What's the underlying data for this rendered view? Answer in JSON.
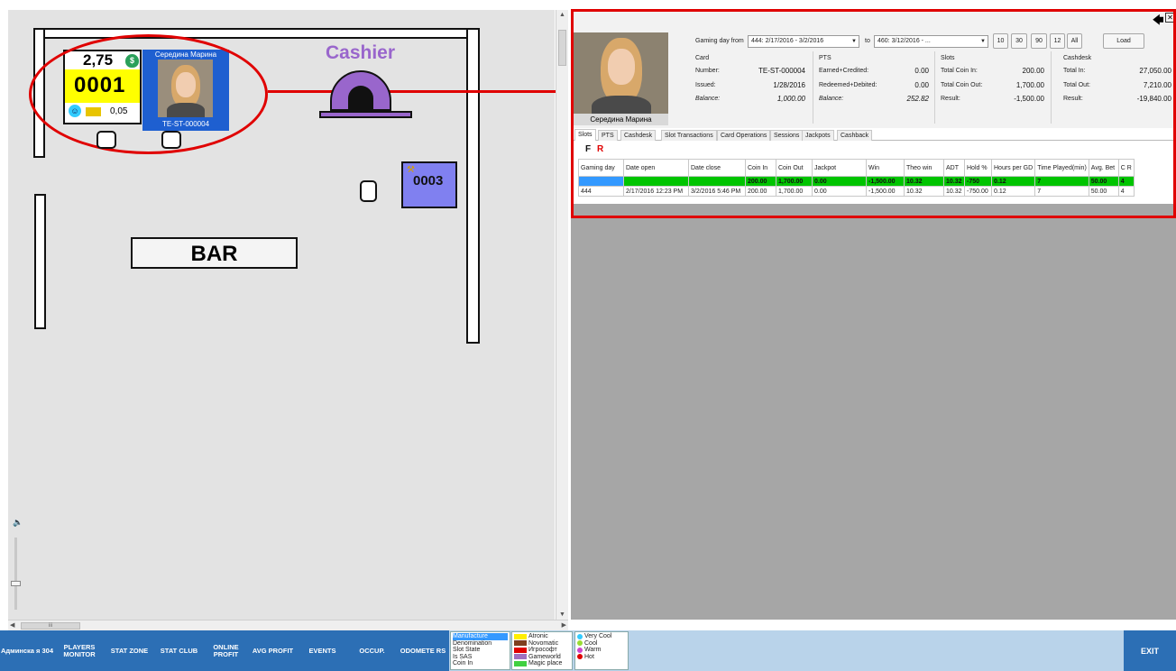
{
  "floor": {
    "cashier_label": "Cashier",
    "bar_label": "BAR",
    "machine_0001": {
      "credit": "2,75",
      "number": "0001",
      "denomination": "0,05",
      "player_name": "Середина Марина",
      "card_number": "TE-ST-000004"
    },
    "machine_0003": {
      "number": "0003"
    }
  },
  "panel": {
    "photo_caption": "Середина Марина",
    "gaming_day_from_label": "Gaming day from",
    "from_value": "444: 2/17/2016 - 3/2/2016",
    "to_label": "to",
    "to_value": "460: 3/12/2016 - ...",
    "range_buttons": [
      "10",
      "30",
      "90",
      "12",
      "All"
    ],
    "load_button": "Load",
    "card": {
      "title": "Card",
      "number_label": "Number:",
      "number_value": "TE-ST-000004",
      "issued_label": "Issued:",
      "issued_value": "1/28/2016",
      "balance_label": "Balance:",
      "balance_value": "1,000.00"
    },
    "pts": {
      "title": "PTS",
      "earned_label": "Earned+Credited:",
      "earned_value": "0.00",
      "redeemed_label": "Redeemed+Debited:",
      "redeemed_value": "0.00",
      "balance_label": "Balance:",
      "balance_value": "252.82"
    },
    "slots": {
      "title": "Slots",
      "coin_in_label": "Total Coin In:",
      "coin_in_value": "200.00",
      "coin_out_label": "Total Coin Out:",
      "coin_out_value": "1,700.00",
      "result_label": "Result:",
      "result_value": "-1,500.00"
    },
    "cashdesk": {
      "title": "Cashdesk",
      "in_label": "Total In:",
      "in_value": "27,050.00",
      "out_label": "Total Out:",
      "out_value": "7,210.00",
      "result_label": "Result:",
      "result_value": "-19,840.00"
    },
    "tabs": [
      "Slots",
      "PTS",
      "Cashdesk",
      "Slot Transactions",
      "Card Operations",
      "Sessions",
      "Jackpots",
      "Cashback"
    ],
    "filter_f": "F",
    "filter_r": "R",
    "grid": {
      "headers": [
        "Gaming day",
        "Date open",
        "Date close",
        "Coin In",
        "Coin Out",
        "Jackpot",
        "Win",
        "Theo win",
        "ADT",
        "Hold %",
        "Hours per GD",
        "Time Played(min)",
        "Avg. Bet",
        "C R"
      ],
      "total_row": [
        "",
        "",
        "",
        "200.00",
        "1,700.00",
        "0.00",
        "-1,500.00",
        "10.32",
        "10.32",
        "-750",
        "0.12",
        "7",
        "50.00",
        "4"
      ],
      "rows": [
        [
          "444",
          "2/17/2016 12:23 PM",
          "3/2/2016 5:46 PM",
          "200.00",
          "1,700.00",
          "0.00",
          "-1,500.00",
          "10.32",
          "10.32",
          "-750.00",
          "0.12",
          "7",
          "50.00",
          "4"
        ]
      ]
    }
  },
  "bottom": {
    "nav": [
      "Админска я 304",
      "PLAYERS MONITOR",
      "STAT ZONE",
      "STAT CLUB",
      "ONLINE PROFIT",
      "AVG PROFIT",
      "EVENTS",
      "OCCUP.",
      "ODOMETE RS"
    ],
    "mode_list": [
      "Manufacture",
      "Denomination",
      "Slot State",
      "Is SAS",
      "Coin In"
    ],
    "manufacturers": [
      {
        "name": "Atronic",
        "color": "#ffee00"
      },
      {
        "name": "Novomatic",
        "color": "#7f3f1f"
      },
      {
        "name": "Игрософт",
        "color": "#e00000"
      },
      {
        "name": "Gameworld",
        "color": "#a070c0"
      },
      {
        "name": "Magic place",
        "color": "#40d040"
      }
    ],
    "moods": [
      {
        "name": "Very Cool",
        "color": "#33ccff"
      },
      {
        "name": "Cool",
        "color": "#99dd33"
      },
      {
        "name": "Warm",
        "color": "#cc44cc"
      },
      {
        "name": "Hot",
        "color": "#e00000"
      }
    ],
    "exit": "EXIT"
  }
}
